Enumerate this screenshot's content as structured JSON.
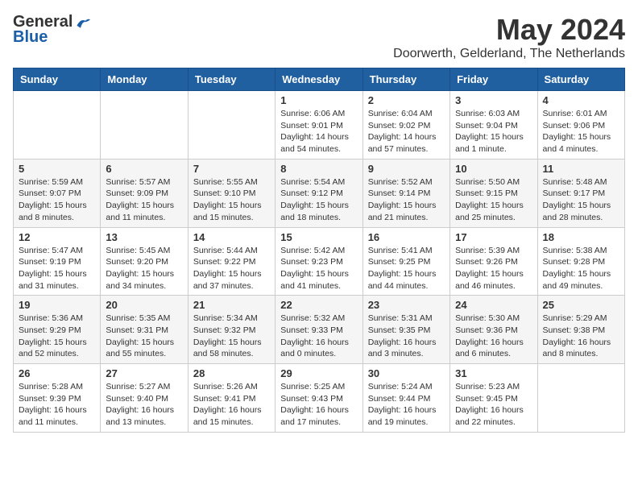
{
  "logo": {
    "general": "General",
    "blue": "Blue"
  },
  "title": "May 2024",
  "subtitle": "Doorwerth, Gelderland, The Netherlands",
  "days_of_week": [
    "Sunday",
    "Monday",
    "Tuesday",
    "Wednesday",
    "Thursday",
    "Friday",
    "Saturday"
  ],
  "weeks": [
    [
      {
        "day": "",
        "info": ""
      },
      {
        "day": "",
        "info": ""
      },
      {
        "day": "",
        "info": ""
      },
      {
        "day": "1",
        "info": "Sunrise: 6:06 AM\nSunset: 9:01 PM\nDaylight: 14 hours\nand 54 minutes."
      },
      {
        "day": "2",
        "info": "Sunrise: 6:04 AM\nSunset: 9:02 PM\nDaylight: 14 hours\nand 57 minutes."
      },
      {
        "day": "3",
        "info": "Sunrise: 6:03 AM\nSunset: 9:04 PM\nDaylight: 15 hours\nand 1 minute."
      },
      {
        "day": "4",
        "info": "Sunrise: 6:01 AM\nSunset: 9:06 PM\nDaylight: 15 hours\nand 4 minutes."
      }
    ],
    [
      {
        "day": "5",
        "info": "Sunrise: 5:59 AM\nSunset: 9:07 PM\nDaylight: 15 hours\nand 8 minutes."
      },
      {
        "day": "6",
        "info": "Sunrise: 5:57 AM\nSunset: 9:09 PM\nDaylight: 15 hours\nand 11 minutes."
      },
      {
        "day": "7",
        "info": "Sunrise: 5:55 AM\nSunset: 9:10 PM\nDaylight: 15 hours\nand 15 minutes."
      },
      {
        "day": "8",
        "info": "Sunrise: 5:54 AM\nSunset: 9:12 PM\nDaylight: 15 hours\nand 18 minutes."
      },
      {
        "day": "9",
        "info": "Sunrise: 5:52 AM\nSunset: 9:14 PM\nDaylight: 15 hours\nand 21 minutes."
      },
      {
        "day": "10",
        "info": "Sunrise: 5:50 AM\nSunset: 9:15 PM\nDaylight: 15 hours\nand 25 minutes."
      },
      {
        "day": "11",
        "info": "Sunrise: 5:48 AM\nSunset: 9:17 PM\nDaylight: 15 hours\nand 28 minutes."
      }
    ],
    [
      {
        "day": "12",
        "info": "Sunrise: 5:47 AM\nSunset: 9:19 PM\nDaylight: 15 hours\nand 31 minutes."
      },
      {
        "day": "13",
        "info": "Sunrise: 5:45 AM\nSunset: 9:20 PM\nDaylight: 15 hours\nand 34 minutes."
      },
      {
        "day": "14",
        "info": "Sunrise: 5:44 AM\nSunset: 9:22 PM\nDaylight: 15 hours\nand 37 minutes."
      },
      {
        "day": "15",
        "info": "Sunrise: 5:42 AM\nSunset: 9:23 PM\nDaylight: 15 hours\nand 41 minutes."
      },
      {
        "day": "16",
        "info": "Sunrise: 5:41 AM\nSunset: 9:25 PM\nDaylight: 15 hours\nand 44 minutes."
      },
      {
        "day": "17",
        "info": "Sunrise: 5:39 AM\nSunset: 9:26 PM\nDaylight: 15 hours\nand 46 minutes."
      },
      {
        "day": "18",
        "info": "Sunrise: 5:38 AM\nSunset: 9:28 PM\nDaylight: 15 hours\nand 49 minutes."
      }
    ],
    [
      {
        "day": "19",
        "info": "Sunrise: 5:36 AM\nSunset: 9:29 PM\nDaylight: 15 hours\nand 52 minutes."
      },
      {
        "day": "20",
        "info": "Sunrise: 5:35 AM\nSunset: 9:31 PM\nDaylight: 15 hours\nand 55 minutes."
      },
      {
        "day": "21",
        "info": "Sunrise: 5:34 AM\nSunset: 9:32 PM\nDaylight: 15 hours\nand 58 minutes."
      },
      {
        "day": "22",
        "info": "Sunrise: 5:32 AM\nSunset: 9:33 PM\nDaylight: 16 hours\nand 0 minutes."
      },
      {
        "day": "23",
        "info": "Sunrise: 5:31 AM\nSunset: 9:35 PM\nDaylight: 16 hours\nand 3 minutes."
      },
      {
        "day": "24",
        "info": "Sunrise: 5:30 AM\nSunset: 9:36 PM\nDaylight: 16 hours\nand 6 minutes."
      },
      {
        "day": "25",
        "info": "Sunrise: 5:29 AM\nSunset: 9:38 PM\nDaylight: 16 hours\nand 8 minutes."
      }
    ],
    [
      {
        "day": "26",
        "info": "Sunrise: 5:28 AM\nSunset: 9:39 PM\nDaylight: 16 hours\nand 11 minutes."
      },
      {
        "day": "27",
        "info": "Sunrise: 5:27 AM\nSunset: 9:40 PM\nDaylight: 16 hours\nand 13 minutes."
      },
      {
        "day": "28",
        "info": "Sunrise: 5:26 AM\nSunset: 9:41 PM\nDaylight: 16 hours\nand 15 minutes."
      },
      {
        "day": "29",
        "info": "Sunrise: 5:25 AM\nSunset: 9:43 PM\nDaylight: 16 hours\nand 17 minutes."
      },
      {
        "day": "30",
        "info": "Sunrise: 5:24 AM\nSunset: 9:44 PM\nDaylight: 16 hours\nand 19 minutes."
      },
      {
        "day": "31",
        "info": "Sunrise: 5:23 AM\nSunset: 9:45 PM\nDaylight: 16 hours\nand 22 minutes."
      },
      {
        "day": "",
        "info": ""
      }
    ]
  ]
}
